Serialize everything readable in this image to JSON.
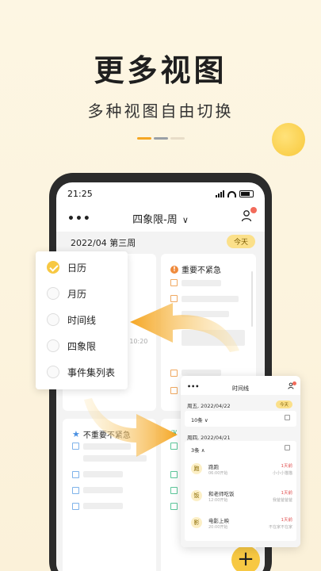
{
  "hero": {
    "headline": "更多视图",
    "subline": "多种视图自由切换"
  },
  "colors": {
    "accent": "#f7c843",
    "arrow": "#f5a623",
    "badge": "#f26b5b"
  },
  "status_bar": {
    "time": "21:25"
  },
  "app_bar": {
    "more": "•••",
    "title": "四象限-周",
    "chevron": "∨"
  },
  "week": {
    "label": "2022/04   第三周",
    "today": "今天"
  },
  "quadrants": {
    "q2_title": "重要不紧急",
    "q3_title": "不重要不紧急",
    "time_hint": ":0 10:20"
  },
  "view_menu": {
    "items": [
      {
        "label": "日历",
        "selected": true
      },
      {
        "label": "月历",
        "selected": false
      },
      {
        "label": "时间线",
        "selected": false
      },
      {
        "label": "四象限",
        "selected": false
      },
      {
        "label": "事件集列表",
        "selected": false
      }
    ]
  },
  "fab": {
    "label": "+"
  },
  "timeline_card": {
    "more": "•••",
    "title": "时间线",
    "date1": "周五, 2022/04/22",
    "today": "今天",
    "count1": "10条  ∨",
    "date2": "周四, 2022/04/21",
    "count2": "3条  ∧",
    "events": [
      {
        "icon": "跑",
        "name": "跑跑",
        "time": "06:00开始",
        "tag": "1天前",
        "sub": "小小小猫猫"
      },
      {
        "icon": "饭",
        "name": "和老师吃饭",
        "time": "12:00开始",
        "tag": "1天前",
        "sub": "我爸爸爸爸"
      },
      {
        "icon": "影",
        "name": "电影上映",
        "time": "20:00开始",
        "tag": "1天前",
        "sub": "不在家不在家"
      }
    ]
  }
}
